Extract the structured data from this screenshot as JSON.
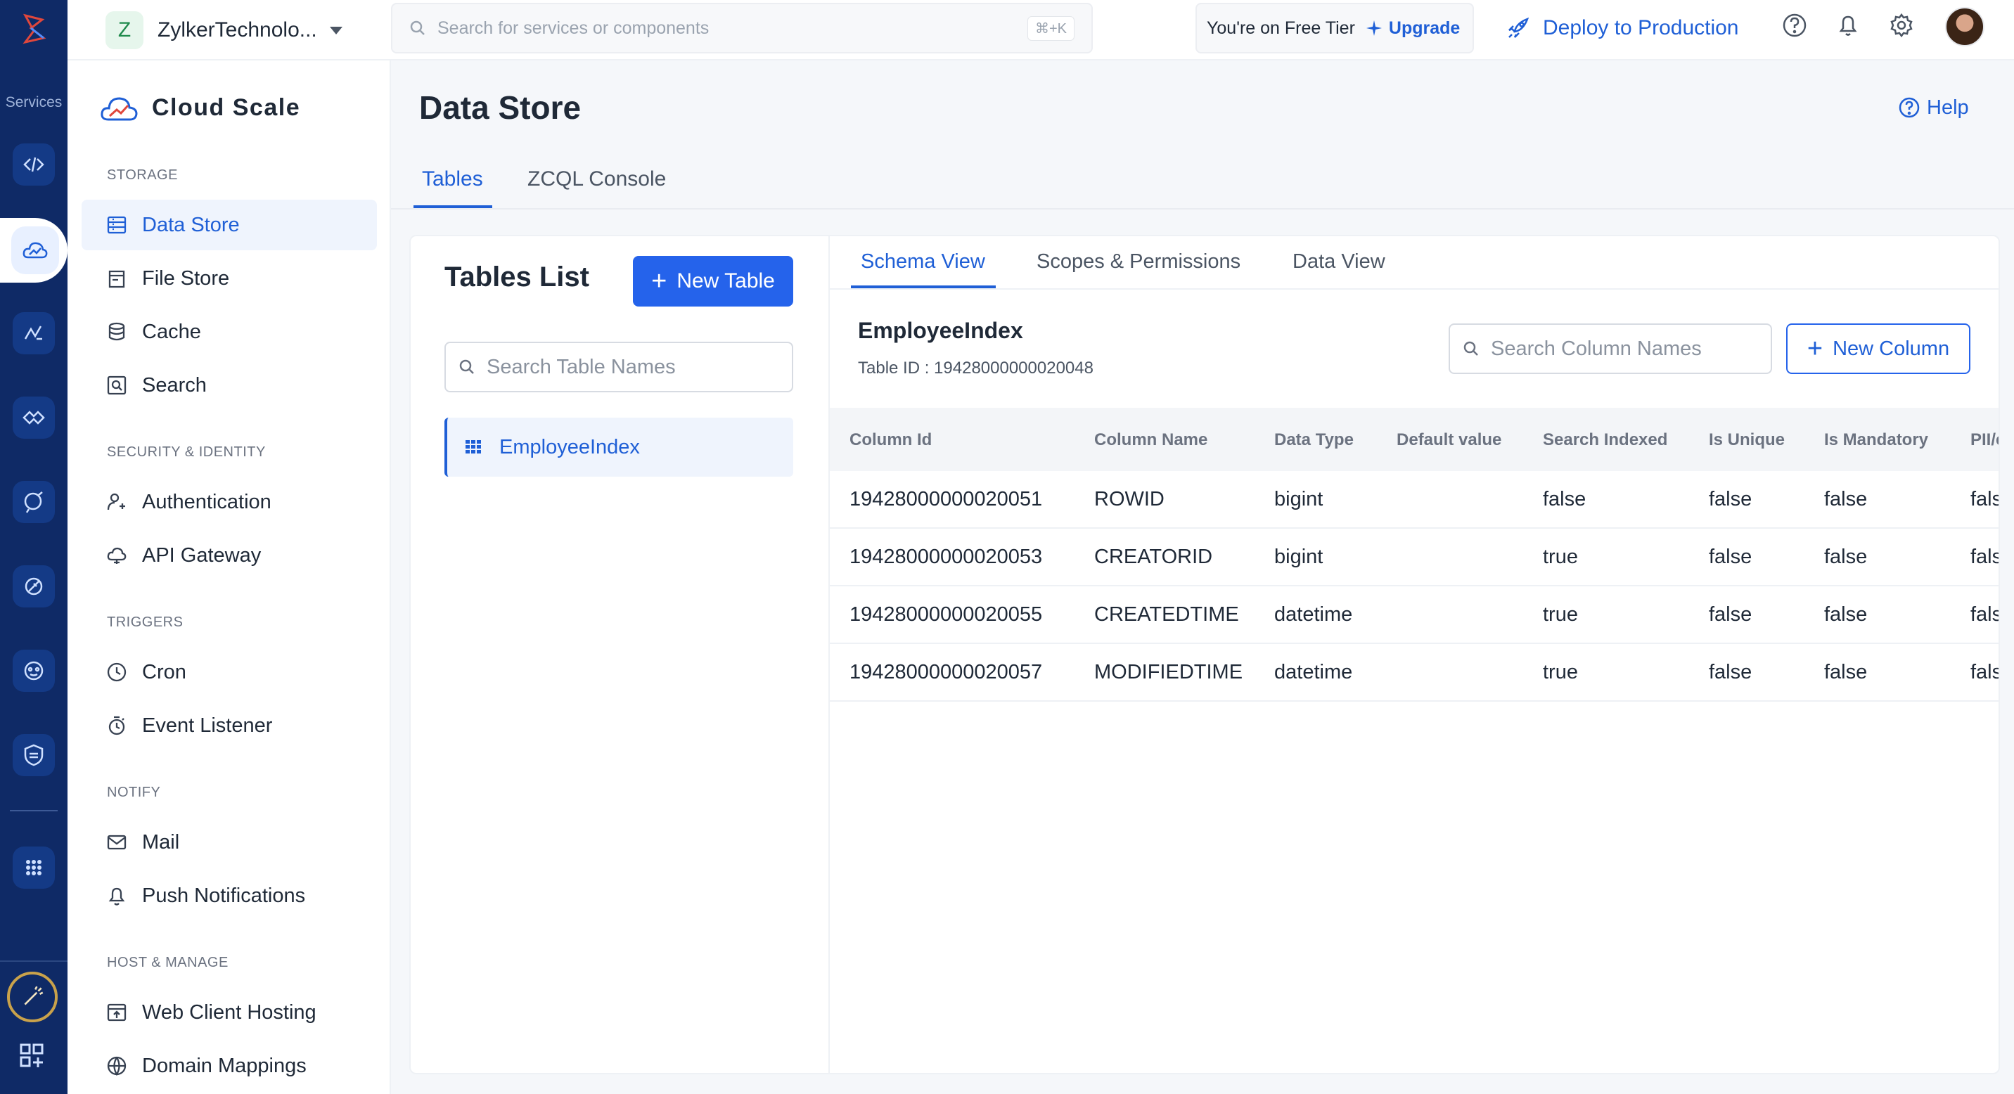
{
  "rail": {
    "label": "Services",
    "items": [
      "code-icon",
      "cloud-scale-icon",
      "signals-icon",
      "handshake-icon",
      "brain-icon",
      "satellite-icon",
      "bot-icon",
      "shield-icon",
      "apps-grid-icon"
    ]
  },
  "topbar": {
    "org_initial": "Z",
    "org_name": "ZylkerTechnolo...",
    "search_placeholder": "Search for services or components",
    "search_shortcut": "⌘+K",
    "tier_text": "You're on Free Tier",
    "upgrade_label": "Upgrade",
    "deploy_label": "Deploy to Production"
  },
  "sidebar": {
    "brand": "Cloud Scale",
    "sections": [
      {
        "title": "STORAGE",
        "items": [
          "Data Store",
          "File Store",
          "Cache",
          "Search"
        ]
      },
      {
        "title": "SECURITY & IDENTITY",
        "items": [
          "Authentication",
          "API Gateway"
        ]
      },
      {
        "title": "TRIGGERS",
        "items": [
          "Cron",
          "Event Listener"
        ]
      },
      {
        "title": "NOTIFY",
        "items": [
          "Mail",
          "Push Notifications"
        ]
      },
      {
        "title": "HOST & MANAGE",
        "items": [
          "Web Client Hosting",
          "Domain Mappings"
        ]
      }
    ]
  },
  "main": {
    "title": "Data Store",
    "help_label": "Help",
    "tabs": [
      "Tables",
      "ZCQL Console"
    ]
  },
  "tables_list": {
    "title": "Tables List",
    "new_table_label": "New Table",
    "search_placeholder": "Search Table Names",
    "tables": [
      "EmployeeIndex"
    ]
  },
  "schema": {
    "tabs": [
      "Schema View",
      "Scopes & Permissions",
      "Data View"
    ],
    "table_name": "EmployeeIndex",
    "table_id_label": "Table ID : 19428000000020048",
    "search_placeholder": "Search Column Names",
    "new_column_label": "New Column",
    "columns": [
      "Column Id",
      "Column Name",
      "Data Type",
      "Default value",
      "Search Indexed",
      "Is Unique",
      "Is Mandatory",
      "PII/ePHI"
    ],
    "rows": [
      [
        "19428000000020051",
        "ROWID",
        "bigint",
        "",
        "false",
        "false",
        "false",
        "false"
      ],
      [
        "19428000000020053",
        "CREATORID",
        "bigint",
        "",
        "true",
        "false",
        "false",
        "false"
      ],
      [
        "19428000000020055",
        "CREATEDTIME",
        "datetime",
        "",
        "true",
        "false",
        "false",
        "false"
      ],
      [
        "19428000000020057",
        "MODIFIEDTIME",
        "datetime",
        "",
        "true",
        "false",
        "false",
        "false"
      ]
    ]
  },
  "colors": {
    "accent": "#2563eb",
    "rail": "#0f2a66"
  }
}
